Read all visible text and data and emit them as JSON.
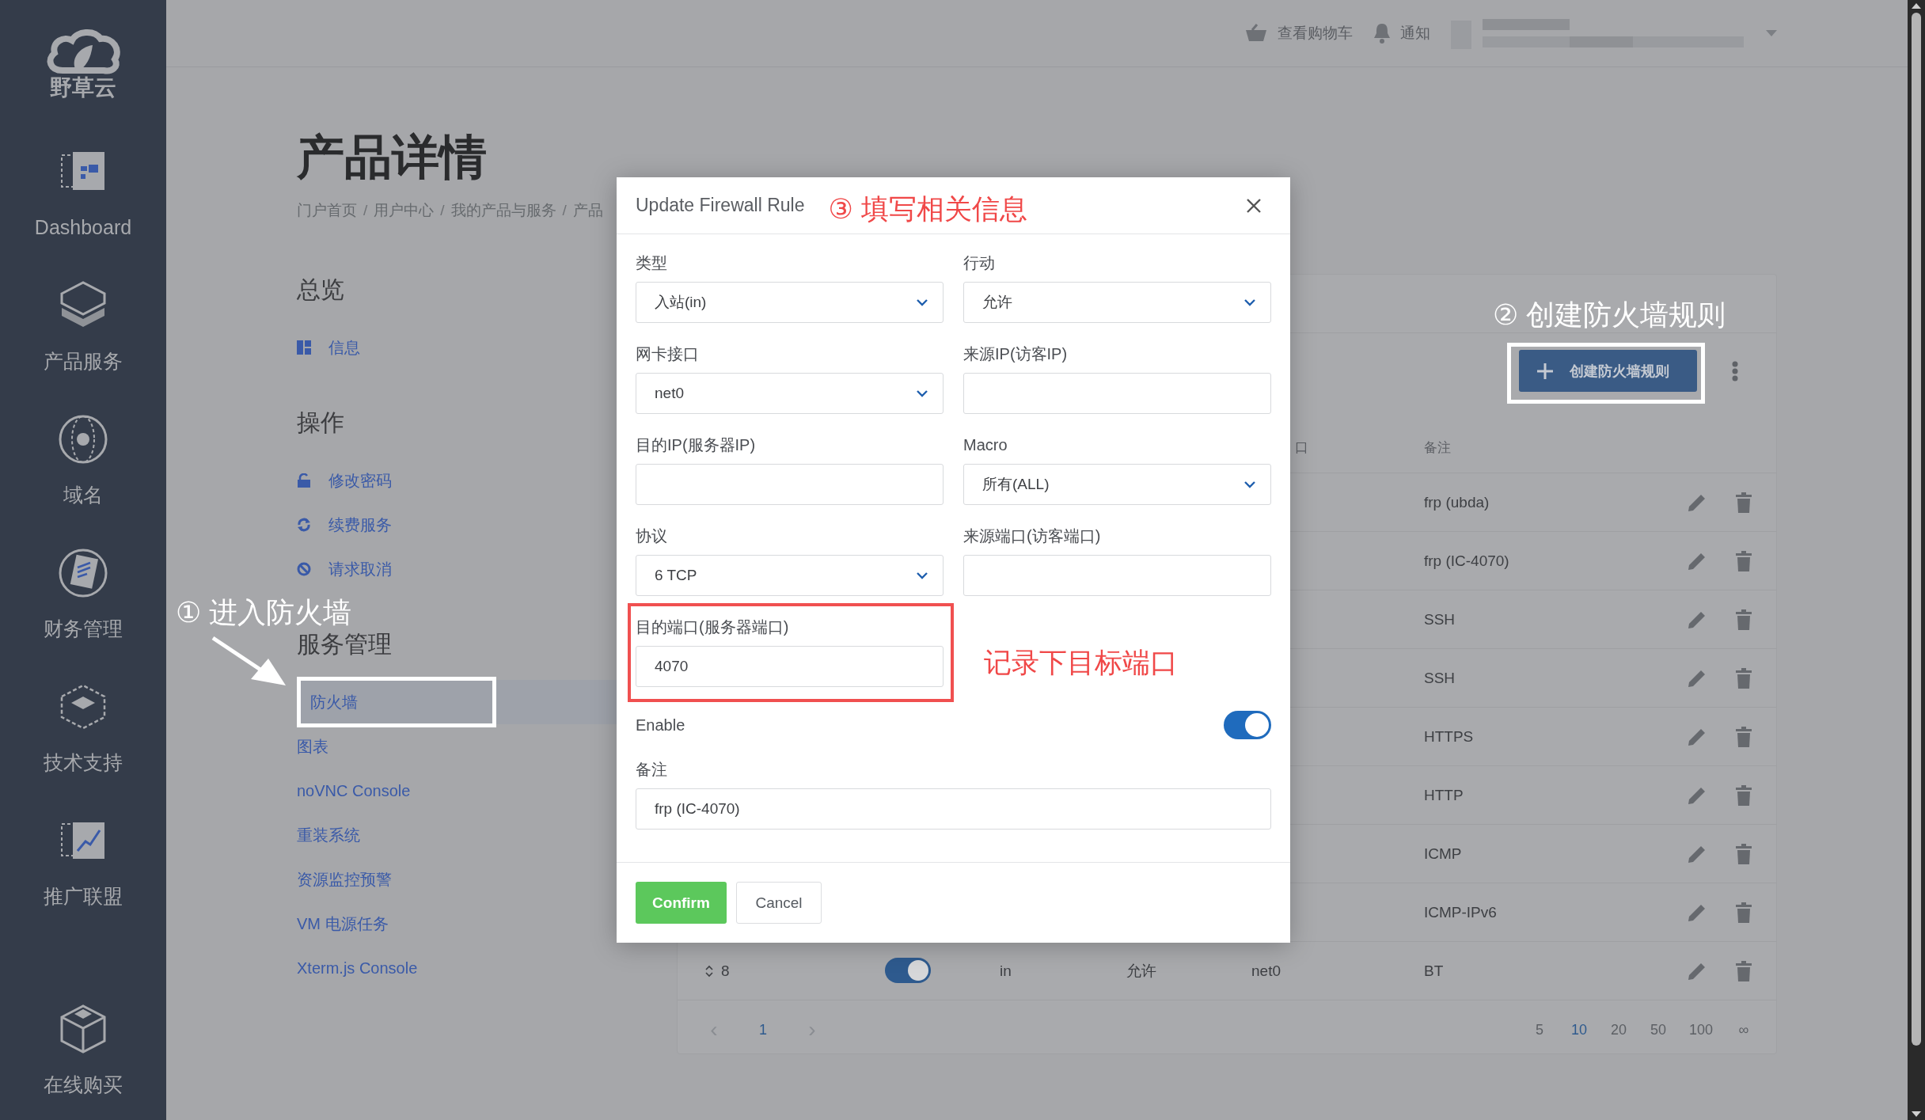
{
  "brand": {
    "name": "野草云"
  },
  "sidebar": {
    "items": [
      {
        "label": "Dashboard"
      },
      {
        "label": "产品服务"
      },
      {
        "label": "域名"
      },
      {
        "label": "财务管理"
      },
      {
        "label": "技术支持"
      },
      {
        "label": "推广联盟"
      },
      {
        "label": "在线购买"
      }
    ]
  },
  "topbar": {
    "cart": "查看购物车",
    "notifications": "通知"
  },
  "page": {
    "title": "产品详情",
    "breadcrumb": [
      "门户首页",
      "用户中心",
      "我的产品与服务",
      "产品"
    ],
    "breadcrumb_separator": "/"
  },
  "menu": {
    "sections": [
      {
        "heading": "总览",
        "items": [
          {
            "label": "信息",
            "selected": false
          }
        ]
      },
      {
        "heading": "操作",
        "items": [
          {
            "label": "修改密码",
            "selected": false
          },
          {
            "label": "续费服务",
            "selected": false
          },
          {
            "label": "请求取消",
            "selected": false
          }
        ]
      },
      {
        "heading": "服务管理",
        "items": [
          {
            "label": "防火墙",
            "selected": true
          },
          {
            "label": "图表",
            "selected": false
          },
          {
            "label": "noVNC Console",
            "selected": false
          },
          {
            "label": "重装系统",
            "selected": false
          },
          {
            "label": "资源监控预警",
            "selected": false
          },
          {
            "label": "VM 电源任务",
            "selected": false
          },
          {
            "label": "Xterm.js Console",
            "selected": false
          }
        ]
      }
    ]
  },
  "card": {
    "create_button": "创建防火墙规则",
    "table": {
      "columns": [
        "口",
        "备注"
      ],
      "rows": [
        {
          "note": "frp (ubda)"
        },
        {
          "note": "frp (IC-4070)"
        },
        {
          "note": "SSH"
        },
        {
          "note": "SSH"
        },
        {
          "note": "HTTPS"
        },
        {
          "note": "HTTP"
        },
        {
          "note": "ICMP"
        },
        {
          "note": "ICMP-IPv6"
        },
        {
          "order": "8",
          "enabled": true,
          "direction": "in",
          "action": "允许",
          "interface": "net0",
          "note": "BT"
        }
      ]
    },
    "pagination": {
      "prev": "‹",
      "next": "›",
      "pages": [
        {
          "label": "1",
          "selected": true
        }
      ],
      "sizes": [
        {
          "label": "5",
          "selected": false
        },
        {
          "label": "10",
          "selected": true
        },
        {
          "label": "20",
          "selected": false
        },
        {
          "label": "50",
          "selected": false
        },
        {
          "label": "100",
          "selected": false
        },
        {
          "label": "∞",
          "selected": false
        }
      ]
    }
  },
  "modal": {
    "title": "Update Firewall Rule",
    "fields": [
      {
        "label": "类型",
        "kind": "select",
        "value": "入站(in)"
      },
      {
        "label": "行动",
        "kind": "select",
        "value": "允许"
      },
      {
        "label": "网卡接口",
        "kind": "select",
        "value": "net0"
      },
      {
        "label": "来源IP(访客IP)",
        "kind": "input"
      },
      {
        "label": "目的IP(服务器IP)",
        "kind": "input"
      },
      {
        "label": "Macro",
        "kind": "select",
        "value": "所有(ALL)"
      },
      {
        "label": "协议",
        "kind": "select",
        "value": "6 TCP"
      },
      {
        "label": "来源端口(访客端口)",
        "kind": "input"
      },
      {
        "label": "目的端口(服务器端口)",
        "kind": "input",
        "value": "4070"
      }
    ],
    "enable": {
      "label": "Enable",
      "on": true
    },
    "note": {
      "label": "备注",
      "value": "frp (IC-4070)"
    },
    "confirm": "Confirm",
    "cancel": "Cancel"
  },
  "annotations": {
    "step1": "① 进入防火墙",
    "step2": "② 创建防火墙规则",
    "step3": "③ 填写相关信息",
    "port_note": "记录下目标端口"
  }
}
